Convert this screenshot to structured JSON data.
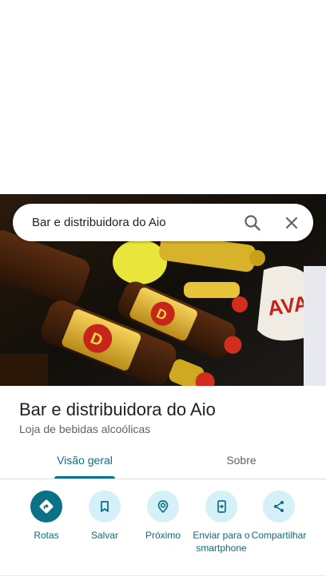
{
  "search": {
    "query": "Bar e distribuidora do Aio",
    "search_icon": "search-icon",
    "close_icon": "close-icon"
  },
  "hero": {
    "image": "photo of beer bottles"
  },
  "place": {
    "name": "Bar e distribuidora do Aio",
    "category": "Loja de bebidas alcoólicas"
  },
  "tabs": [
    {
      "label": "Visão geral",
      "active": true
    },
    {
      "label": "Sobre",
      "active": false
    }
  ],
  "actions": [
    {
      "label": "Rotas",
      "icon": "directions-icon"
    },
    {
      "label": "Salvar",
      "icon": "bookmark-icon"
    },
    {
      "label": "Próximo",
      "icon": "nearby-icon"
    },
    {
      "label": "Enviar para o smartphone",
      "icon": "send-to-phone-icon"
    },
    {
      "label": "Compartilhar",
      "icon": "share-icon"
    }
  ],
  "colors": {
    "accent": "#0b7285",
    "action_bg": "#d5f0f7",
    "text_primary": "#202124",
    "text_secondary": "#5f6368"
  }
}
